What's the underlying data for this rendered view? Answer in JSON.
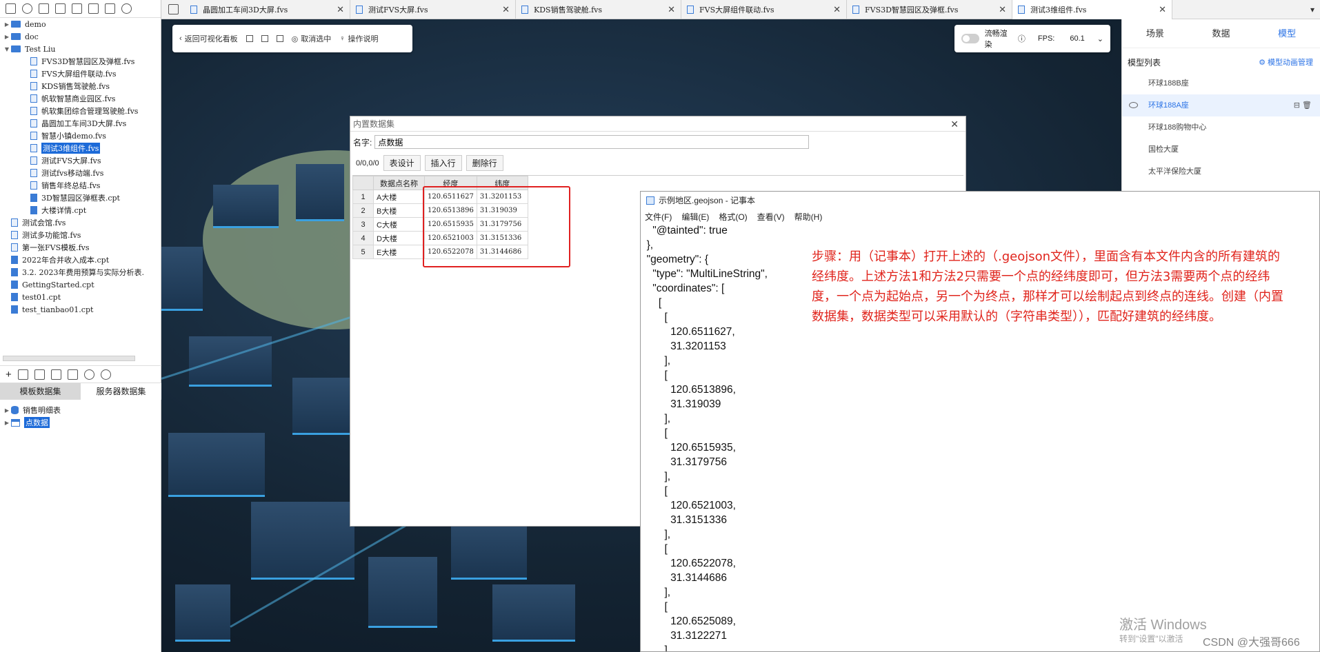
{
  "left_panel": {
    "tree": [
      {
        "level": 0,
        "type": "folder",
        "label": "demo"
      },
      {
        "level": 0,
        "type": "folder",
        "label": "doc"
      },
      {
        "level": 0,
        "type": "folder",
        "label": "Test Liu",
        "expanded": true
      },
      {
        "level": 1,
        "type": "fvs",
        "label": "FVS3D智慧园区及弹框.fvs"
      },
      {
        "level": 1,
        "type": "fvs",
        "label": "FVS大屏组件联动.fvs"
      },
      {
        "level": 1,
        "type": "fvs",
        "label": "KDS销售驾驶舱.fvs"
      },
      {
        "level": 1,
        "type": "fvs",
        "label": "帆软智慧商业园区.fvs"
      },
      {
        "level": 1,
        "type": "fvs",
        "label": "帆软集团综合管理驾驶舱.fvs"
      },
      {
        "level": 1,
        "type": "fvs",
        "label": "晶圆加工车间3D大屏.fvs"
      },
      {
        "level": 1,
        "type": "fvs",
        "label": "智慧小镇demo.fvs"
      },
      {
        "level": 1,
        "type": "fvs",
        "label": "测试3维组件.fvs",
        "selected": true
      },
      {
        "level": 1,
        "type": "fvs",
        "label": "测试FVS大屏.fvs"
      },
      {
        "level": 1,
        "type": "fvs",
        "label": "测试fvs移动端.fvs"
      },
      {
        "level": 1,
        "type": "fvs",
        "label": "销售年终总结.fvs"
      },
      {
        "level": 1,
        "type": "cpt",
        "label": "3D智慧园区弹框表.cpt"
      },
      {
        "level": 1,
        "type": "cpt",
        "label": "大楼详情.cpt"
      },
      {
        "level": 0,
        "type": "fvs",
        "label": "测试会馆.fvs"
      },
      {
        "level": 0,
        "type": "fvs",
        "label": "测试多功能馆.fvs"
      },
      {
        "level": 0,
        "type": "fvs",
        "label": "第一张FVS模板.fvs"
      },
      {
        "level": 0,
        "type": "cpt",
        "label": "2022年合并收入成本.cpt"
      },
      {
        "level": 0,
        "type": "cpt",
        "label": "3.2. 2023年费用预算与实际分析表."
      },
      {
        "level": 0,
        "type": "cpt",
        "label": "GettingStarted.cpt"
      },
      {
        "level": 0,
        "type": "cpt",
        "label": "test01.cpt"
      },
      {
        "level": 0,
        "type": "cpt",
        "label": "test_tianbao01.cpt"
      }
    ],
    "dataset_tabs": [
      "模板数据集",
      "服务器数据集"
    ],
    "datasets": [
      {
        "type": "db",
        "label": "销售明细表"
      },
      {
        "type": "embedded",
        "label": "点数据",
        "selected": true
      }
    ]
  },
  "tabs": [
    {
      "title": "晶圆加工车间3D大屏.fvs"
    },
    {
      "title": "测试FVS大屏.fvs"
    },
    {
      "title": "KDS销售驾驶舱.fvs"
    },
    {
      "title": "FVS大屏组件联动.fvs"
    },
    {
      "title": "FVS3D智慧园区及弹框.fvs"
    },
    {
      "title": "测试3维组件.fvs",
      "active": true
    }
  ],
  "scene_toolbar": {
    "back_label": "返回可视化看板",
    "cancel_select_label": "取消选中",
    "help_label": "操作说明"
  },
  "fps": {
    "smooth_label": "流畅渲染",
    "fps_label": "FPS:",
    "fps_value": "60.1"
  },
  "right_panel": {
    "tabs": [
      "场景",
      "数据",
      "模型"
    ],
    "active_tab": "模型",
    "list_title": "模型列表",
    "anim_link": "模型动画管理",
    "items": [
      "环球188B座",
      "环球188A座",
      "环球188购物中心",
      "国检大厦",
      "太平洋保险大厦"
    ],
    "active_item": "环球188A座"
  },
  "dataset_dialog": {
    "title": "内置数据集",
    "name_label": "名字:",
    "name_value": "点数据",
    "position": "0/0,0/0",
    "btn_design": "表设计",
    "btn_insert": "插入行",
    "btn_delete": "删除行",
    "columns": [
      "数据点名称",
      "经度",
      "纬度"
    ],
    "rows": [
      [
        "1",
        "A大楼",
        "120.6511627",
        "31.3201153"
      ],
      [
        "2",
        "B大楼",
        "120.6513896",
        "31.319039"
      ],
      [
        "3",
        "C大楼",
        "120.6515935",
        "31.3179756"
      ],
      [
        "4",
        "D大楼",
        "120.6521003",
        "31.3151336"
      ],
      [
        "5",
        "E大楼",
        "120.6522078",
        "31.3144686"
      ]
    ]
  },
  "notepad": {
    "title": "示例地区.geojson - 记事本",
    "menu": [
      "文件(F)",
      "编辑(E)",
      "格式(O)",
      "查看(V)",
      "帮助(H)"
    ],
    "lines": [
      "    \"@tainted\": true",
      "  },",
      "  \"geometry\": {",
      "    \"type\": \"MultiLineString\",",
      "    \"coordinates\": [",
      "      [",
      "        [",
      "          120.6511627,",
      "          31.3201153",
      "        ],",
      "        [",
      "          120.6513896,",
      "          31.319039",
      "        ],",
      "        [",
      "          120.6515935,",
      "          31.3179756",
      "        ],",
      "        [",
      "          120.6521003,",
      "          31.3151336",
      "        ],",
      "        [",
      "          120.6522078,",
      "          31.3144686",
      "        ],",
      "        [",
      "          120.6525089,",
      "          31.3122271",
      "        ]"
    ],
    "note": "步骤：用（记事本）打开上述的（.geojson文件），里面含有本文件内含的所有建筑的经纬度。上述方法1和方法2只需要一个点的经纬度即可，但方法3需要两个点的经纬度，一个点为起始点，另一个为终点，那样才可以绘制起点到终点的连线。创建（内置数据集，数据类型可以采用默认的（字符串类型）），匹配好建筑的经纬度。"
  },
  "watermark": {
    "line1": "激活 Windows",
    "line2": "转到\"设置\"以激活",
    "csdn": "CSDN @大强哥666"
  },
  "colors": {
    "accent": "#2b73e6",
    "highlight_box": "#e02020",
    "note_text": "#e0241c",
    "selection": "#1c6ad8"
  }
}
